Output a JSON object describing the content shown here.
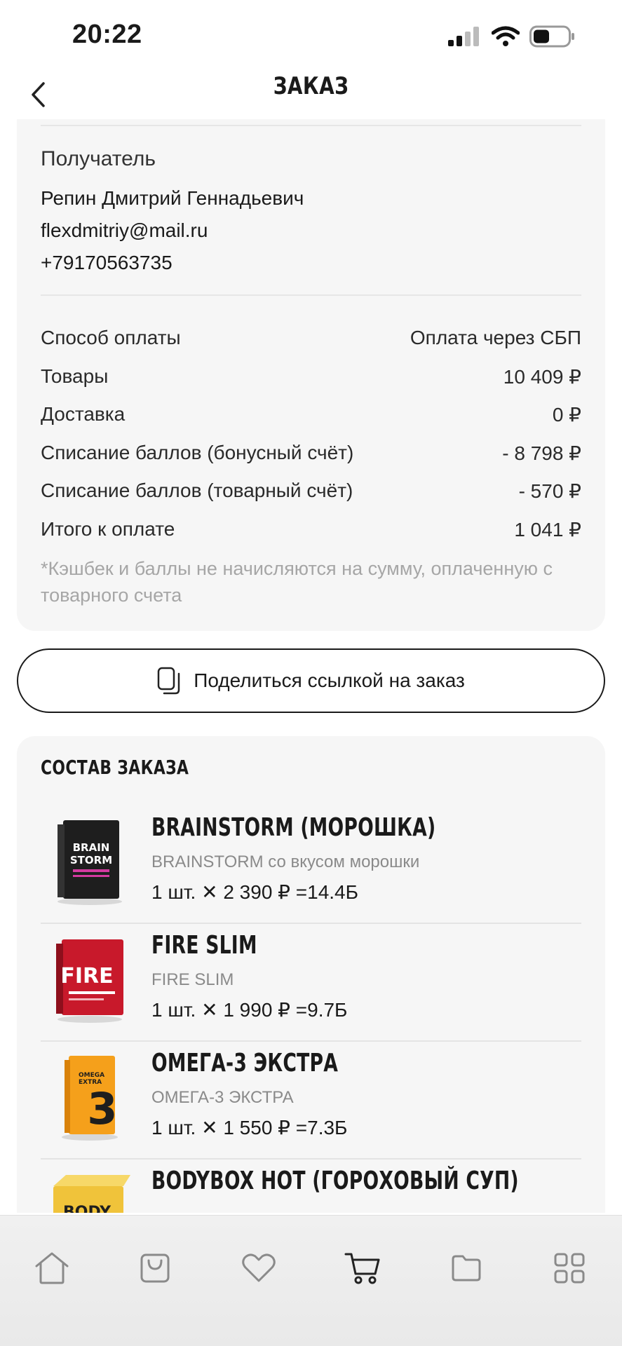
{
  "status": {
    "time": "20:22"
  },
  "nav": {
    "title": "ЗАКАЗ"
  },
  "recipient": {
    "title": "Получатель",
    "name": "Репин Дмитрий Геннадьевич",
    "email": "flexdmitriy@mail.ru",
    "phone": "+79170563735"
  },
  "summary": [
    {
      "label": "Способ оплаты",
      "value": "Оплата через СБП"
    },
    {
      "label": "Товары",
      "value": "10 409 ₽"
    },
    {
      "label": "Доставка",
      "value": "0 ₽"
    },
    {
      "label": "Списание баллов (бонусный счёт)",
      "value": "- 8 798 ₽"
    },
    {
      "label": "Списание баллов (товарный счёт)",
      "value": "- 570 ₽"
    },
    {
      "label": "Итого к оплате",
      "value": "1 041 ₽"
    }
  ],
  "note": "*Кэшбек и баллы не начисляются на сумму, оплаченную с товарного счета",
  "share_label": "Поделиться ссылкой на заказ",
  "items_title": "СОСТАВ ЗАКАЗА",
  "items": [
    {
      "name": "BRAINSTORM (МОРОШКА)",
      "desc": "BRAINSTORM со вкусом морошки",
      "price": "1 шт. ✕ 2 390 ₽  =14.4Б",
      "img_text": "BRAIN STORM",
      "img_color": "#1e1e1e",
      "img_accent": "#d43aa0"
    },
    {
      "name": "FIRE SLIM",
      "desc": "FIRE SLIM",
      "price": "1 шт. ✕ 1 990 ₽  =9.7Б",
      "img_text": "FIRE",
      "img_color": "#c8192b",
      "img_accent": "#ffffff"
    },
    {
      "name": "ОМЕГА-3 ЭКСТРА",
      "desc": "ОМЕГА-3 ЭКСТРА",
      "price": "1 шт. ✕ 1 550 ₽  =7.3Б",
      "img_text": "3",
      "img_color": "#f5a01b",
      "img_accent": "#1e1e1e"
    },
    {
      "name": "BODYBOX HOT (ГОРОХОВЫЙ СУП)",
      "desc": "",
      "price": "",
      "img_text": "BODY",
      "img_color": "#f0c33a",
      "img_accent": "#1e1e1e"
    }
  ],
  "tabs": [
    "home-icon",
    "bag-icon",
    "heart-icon",
    "cart-icon",
    "folder-icon",
    "grid-icon"
  ]
}
